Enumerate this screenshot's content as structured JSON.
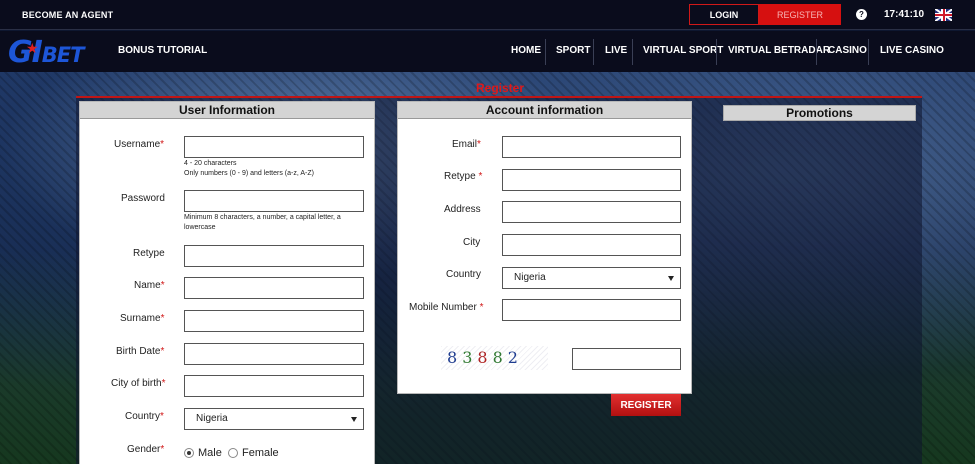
{
  "topbar": {
    "agent_label": "BECOME AN AGENT",
    "login_label": "LOGIN",
    "register_label": "REGISTER",
    "help_icon_char": "?",
    "time": "17:41:10",
    "flag_icon": "uk-flag-icon"
  },
  "navbar": {
    "logo_gi": "GI",
    "logo_bet": "BET",
    "bonus_label": "BONUS TUTORIAL",
    "items": [
      "HOME",
      "SPORT",
      "LIVE",
      "VIRTUAL SPORT",
      "VIRTUAL BETRADAR",
      "CASINO",
      "LIVE CASINO"
    ]
  },
  "page": {
    "title": "Register"
  },
  "user_info": {
    "heading": "User Information",
    "username_label": "Username",
    "username_hint_1": "4 - 20 characters",
    "username_hint_2": "Only numbers (0 - 9) and letters (a-z, A-Z)",
    "password_label": "Password",
    "password_hint_1": "Minimum 8 characters, a number, a capital letter, a",
    "password_hint_2": "lowercase",
    "retype_label": "Retype",
    "name_label": "Name",
    "surname_label": "Surname",
    "birth_date_label": "Birth Date",
    "city_of_birth_label": "City of birth",
    "country_label": "Country",
    "country_value": "Nigeria",
    "gender_label": "Gender",
    "gender_male": "Male",
    "gender_female": "Female",
    "gender_selected": "Male",
    "required_mark": "*"
  },
  "account_info": {
    "heading": "Account information",
    "email_label": "Email",
    "retype_label": "Retype ",
    "address_label": "Address",
    "city_label": "City",
    "country_label": "Country",
    "country_value": "Nigeria",
    "mobile_label": "Mobile Number ",
    "captcha_text": [
      "8",
      "3",
      "8",
      "8",
      "2"
    ],
    "register_button": "REGISTER",
    "required_mark": "*"
  },
  "promotions": {
    "heading": "Promotions"
  },
  "colors": {
    "accent_red": "#d61010",
    "topbar_bg": "#0a0c1c",
    "logo_blue": "#1d56d8"
  }
}
